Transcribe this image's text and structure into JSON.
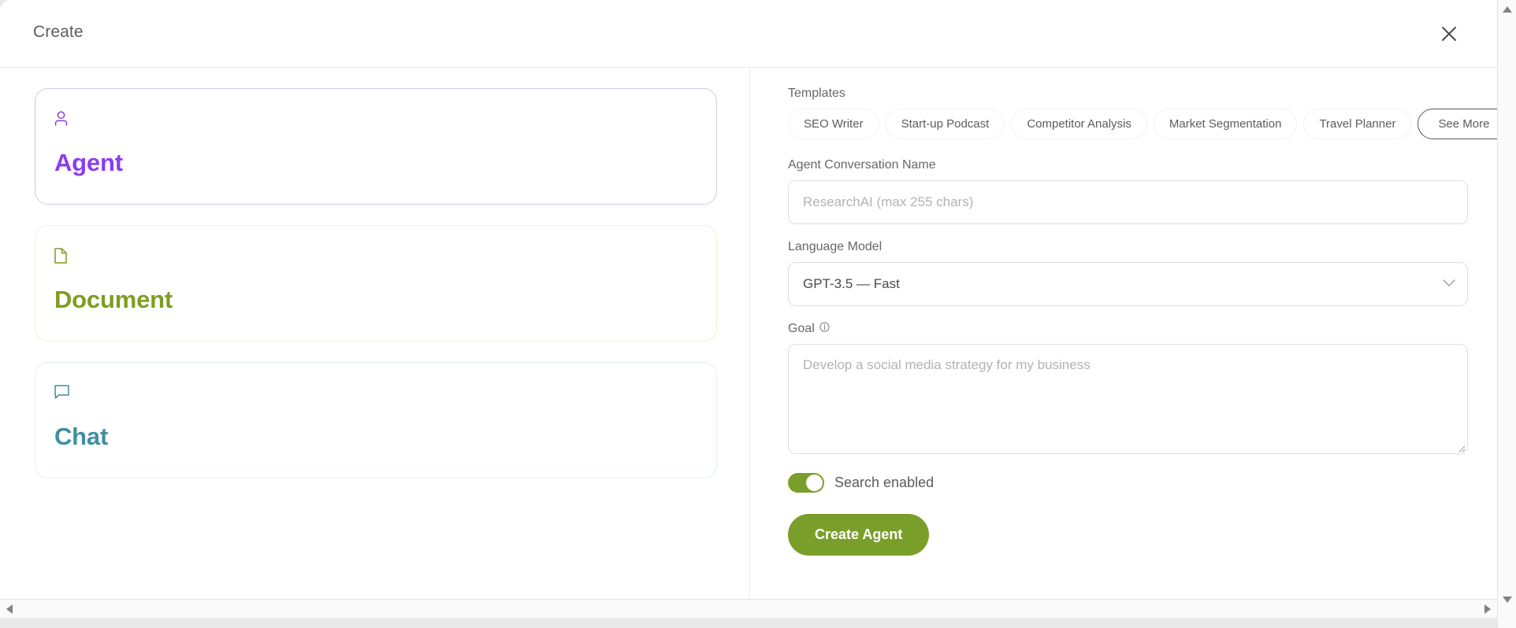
{
  "window": {
    "title": "Create",
    "close_icon": "close-icon"
  },
  "left_pane": {
    "cards": [
      {
        "label": "Agent",
        "icon": "person-icon",
        "color": "#8b3cf0",
        "border": "#d3c6f0"
      },
      {
        "label": "Document",
        "icon": "file-document-icon",
        "color": "#7f9c22",
        "border": "#f2f0cf"
      },
      {
        "label": "Chat",
        "icon": "chat-bubble-icon",
        "color": "#3f8fa1",
        "border": "#e4f0f1"
      }
    ]
  },
  "right_pane": {
    "templates_label": "Templates",
    "templates": [
      "SEO Writer",
      "Start-up Podcast",
      "Competitor Analysis",
      "Market Segmentation",
      "Travel Planner"
    ],
    "see_more_label": "See More",
    "name_field": {
      "label": "Agent Conversation Name",
      "value": "",
      "placeholder": "ResearchAI (max 255 chars)"
    },
    "model_field": {
      "label": "Language Model",
      "selected": "GPT-3.5 — Fast",
      "chevron_icon": "chevron-down-icon"
    },
    "goal_field": {
      "label": "Goal",
      "info_icon": "info-icon",
      "value": "",
      "placeholder": "Develop a social media strategy for my business"
    },
    "search_toggle": {
      "label": "Search enabled",
      "enabled": true,
      "color": "#7a9e2a"
    },
    "submit_label": "Create Agent",
    "submit_color": "#7a9e2a"
  },
  "scrollbars": {
    "up_icon": "arrow-up-icon",
    "down_icon": "arrow-down-icon",
    "left_icon": "arrow-left-icon",
    "right_icon": "arrow-right-icon"
  }
}
